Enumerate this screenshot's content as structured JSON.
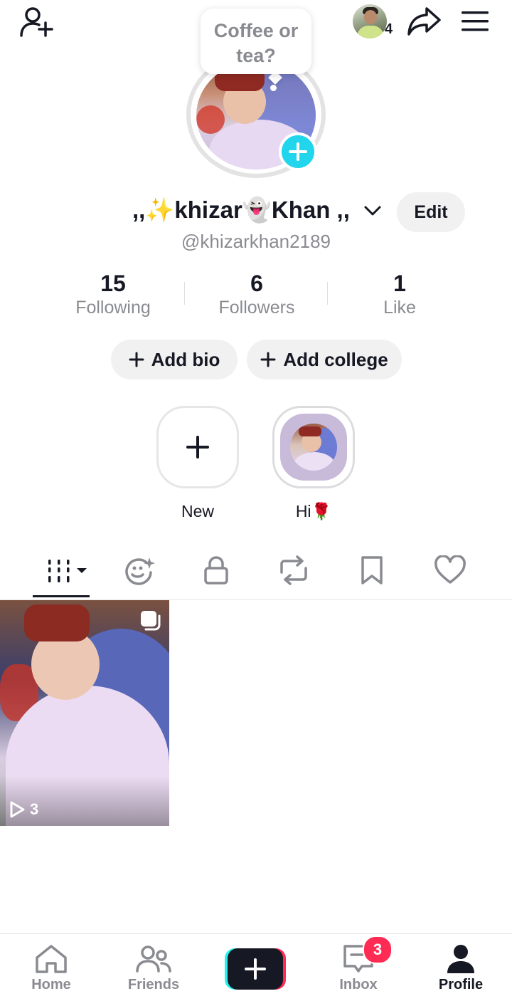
{
  "header": {
    "friends_count": "4",
    "status_bubble": "Coffee or tea?"
  },
  "profile": {
    "display_name": ",,✨khizar👻Khan ,,",
    "username": "@khizarkhan2189",
    "edit_label": "Edit"
  },
  "stats": [
    {
      "value": "15",
      "label": "Following"
    },
    {
      "value": "6",
      "label": "Followers"
    },
    {
      "value": "1",
      "label": "Like"
    }
  ],
  "actions": {
    "add_bio": "Add bio",
    "add_college": "Add college"
  },
  "highlights": [
    {
      "label": "New"
    },
    {
      "label": "Hi🌹"
    }
  ],
  "tabs": [
    "videos-grid",
    "reposts-emoji",
    "private",
    "reposts",
    "favorites",
    "liked"
  ],
  "videos": [
    {
      "views": "3"
    }
  ],
  "nav": {
    "home": "Home",
    "friends": "Friends",
    "inbox": "Inbox",
    "inbox_badge": "3",
    "profile": "Profile"
  },
  "colors": {
    "accent_cyan": "#25f4ee",
    "accent_red": "#fe2c55",
    "text_primary": "#161823",
    "text_secondary": "#8a8b91"
  }
}
